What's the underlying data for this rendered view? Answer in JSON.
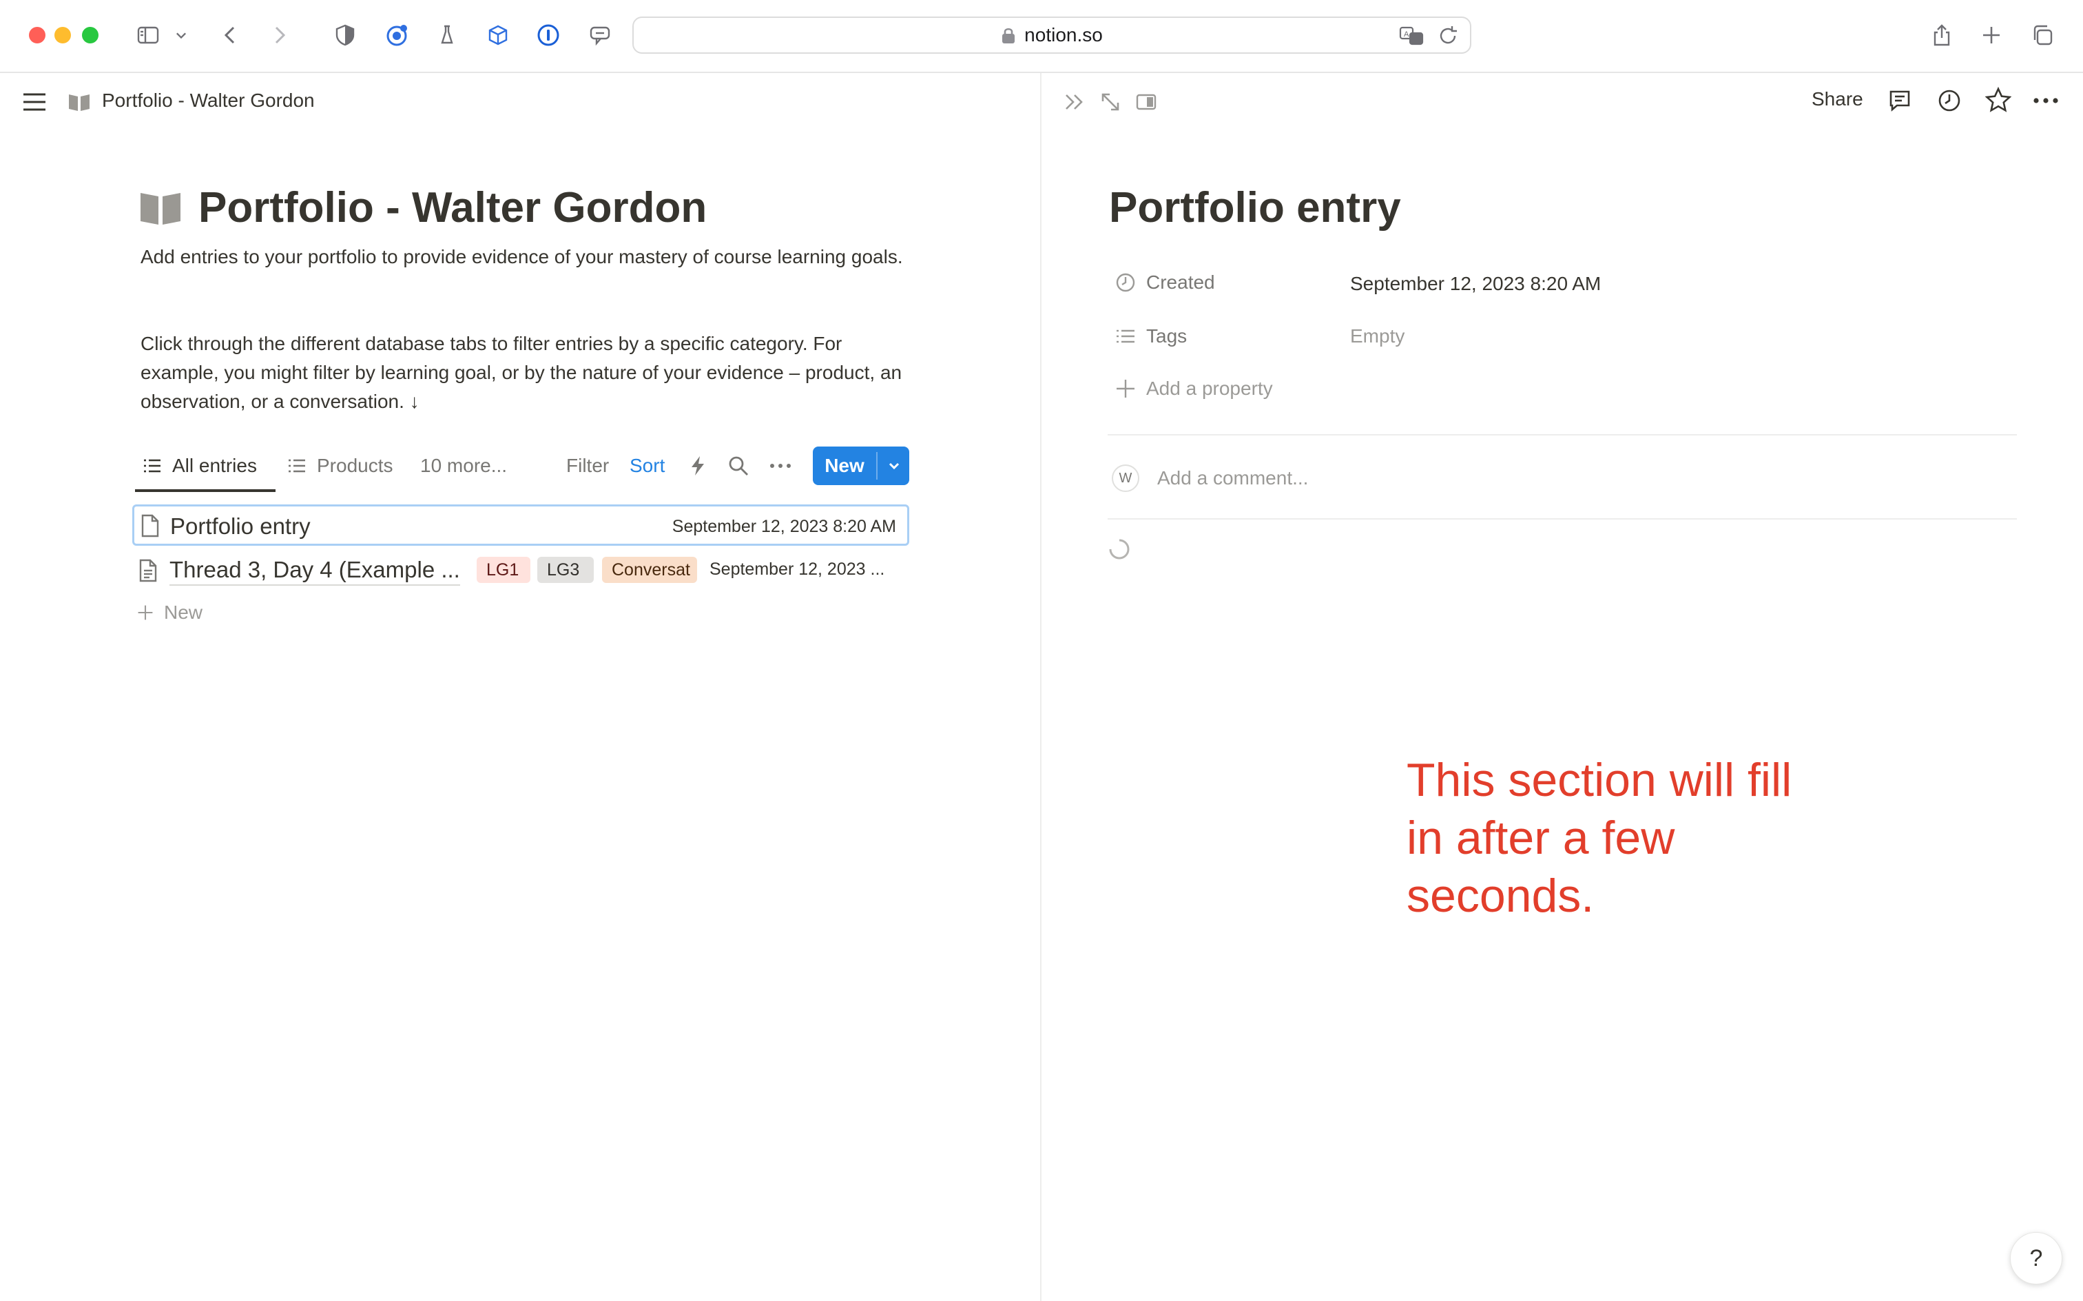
{
  "browser": {
    "url": "notion.so"
  },
  "left_pane": {
    "breadcrumb": "Portfolio - Walter Gordon",
    "title": "Portfolio - Walter Gordon",
    "description_1": "Add entries to your portfolio to provide evidence of your mastery of course learning goals.",
    "description_2": "Click through the different database tabs to filter entries by a specific category. For example, you might filter by learning goal, or by the nature of your evidence – product, an observation, or a conversation. ↓",
    "tabs": [
      {
        "label": "All entries",
        "active": true
      },
      {
        "label": "Products",
        "active": false
      },
      {
        "label": "10 more...",
        "active": false
      }
    ],
    "toolbar": {
      "filter": "Filter",
      "sort": "Sort",
      "new": "New"
    },
    "rows": [
      {
        "title": "Portfolio entry",
        "date": "September 12, 2023 8:20 AM",
        "tags": []
      },
      {
        "title": "Thread 3, Day 4 (Example ...",
        "date": "September 12, 2023 ...",
        "tags": [
          "LG1",
          "LG3",
          "Conversat"
        ]
      }
    ],
    "new_row": "New"
  },
  "right_pane": {
    "share": "Share",
    "title": "Portfolio entry",
    "properties": [
      {
        "label": "Created",
        "value": "September 12, 2023 8:20 AM"
      },
      {
        "label": "Tags",
        "value": "Empty"
      }
    ],
    "add_property": "Add a property",
    "avatar_initial": "W",
    "comment_placeholder": "Add a comment...",
    "note": "This section will fill in after a few seconds.",
    "help": "?"
  },
  "colors": {
    "accent_blue": "#2383e2",
    "note_red": "#e23e2b",
    "tag_gray": "#e3e2e0",
    "tag_red": "#ffe2dd",
    "tag_orange": "#fadec9"
  }
}
